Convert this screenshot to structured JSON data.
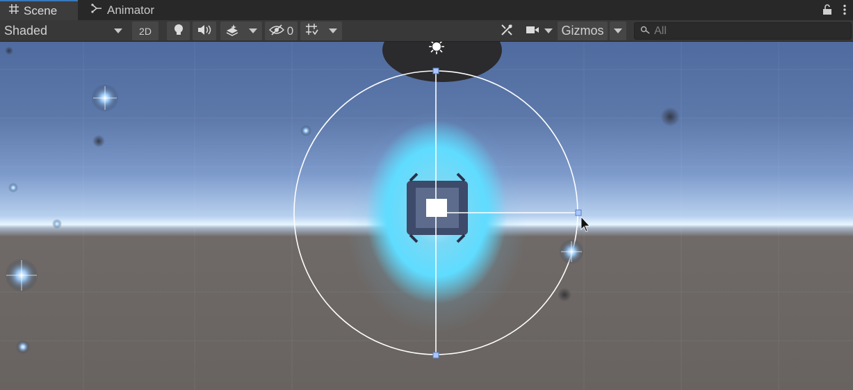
{
  "tabs": [
    {
      "label": "Scene",
      "icon": "grid-hash-icon",
      "active": true
    },
    {
      "label": "Animator",
      "icon": "animator-node-icon",
      "active": false
    }
  ],
  "toolbar": {
    "draw_mode": "Shaded",
    "two_d_label": "2D",
    "hidden_count": "0",
    "gizmos_label": "Gizmos",
    "search_placeholder": "All"
  },
  "icons": {
    "lighting": "lightbulb-icon",
    "audio": "speaker-icon",
    "effects": "layers-effects-icon",
    "visibility": "eye-slash-icon",
    "grid": "grid-snap-icon",
    "tools": "tools-icon",
    "camera": "camera-icon",
    "lock": "lock-icon",
    "menu": "kebab-menu-icon",
    "search": "search-icon"
  },
  "colors": {
    "accent": "#3a79bb",
    "glow": "#5fdcff",
    "ground": "#686360",
    "sky": "#5d79aa"
  }
}
